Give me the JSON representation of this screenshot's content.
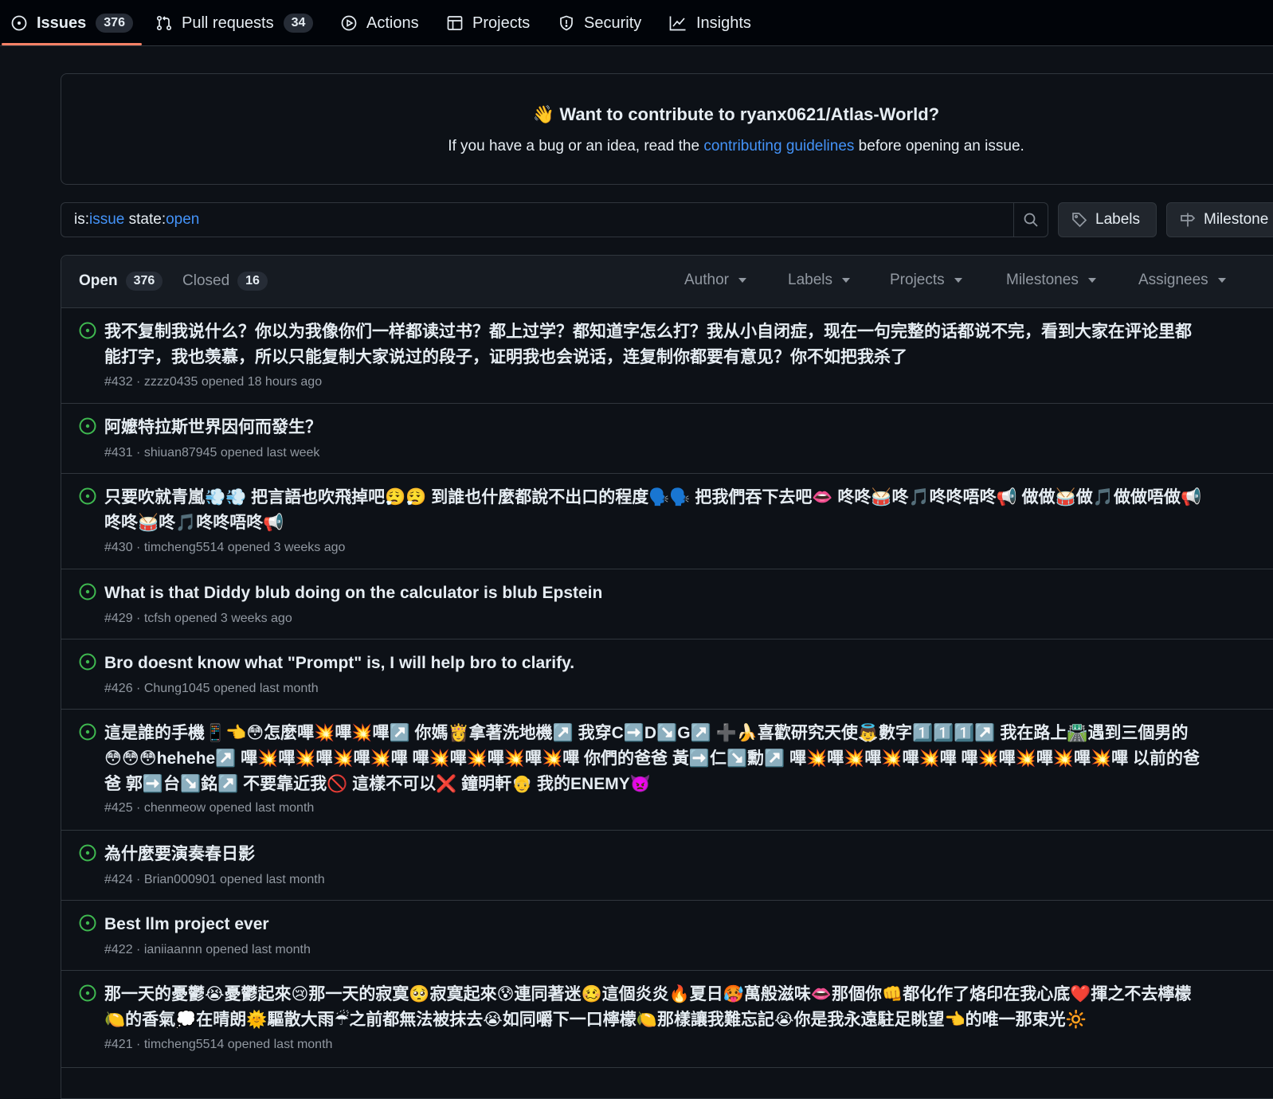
{
  "nav": {
    "tabs": [
      {
        "label": "Issues",
        "count": "376",
        "icon": "issue-opened-icon"
      },
      {
        "label": "Pull requests",
        "count": "34",
        "icon": "git-pull-request-icon"
      },
      {
        "label": "Actions",
        "icon": "play-icon"
      },
      {
        "label": "Projects",
        "icon": "table-icon"
      },
      {
        "label": "Security",
        "icon": "shield-icon"
      },
      {
        "label": "Insights",
        "icon": "graph-icon"
      }
    ]
  },
  "banner": {
    "title": "👋 Want to contribute to ryanx0621/Atlas-World?",
    "text_before": "If you have a bug or an idea, read the ",
    "link": "contributing guidelines",
    "text_after": " before opening an issue."
  },
  "search": {
    "prefix1": "is:",
    "value1": "issue",
    "prefix2": " state:",
    "value2": "open",
    "labels_button": "Labels",
    "milestones_button": "Milestone"
  },
  "list_header": {
    "open_label": "Open",
    "open_count": "376",
    "closed_label": "Closed",
    "closed_count": "16",
    "filters": [
      "Author",
      "Labels",
      "Projects",
      "Milestones",
      "Assignees"
    ]
  },
  "issues": [
    {
      "title": "我不复制我说什么？你以为我像你们一样都读过书？都上过学？都知道字怎么打？我从小自闭症，现在一句完整的话都说不完，看到大家在评论里都能打字，我也羡慕，所以只能复制大家说过的段子，证明我也会说话，连复制你都要有意见？你不如把我杀了",
      "meta": "#432 · zzzz0435 opened 18 hours ago"
    },
    {
      "title": "阿嬤特拉斯世界因何而發生？",
      "meta": "#431 · shiuan87945 opened last week"
    },
    {
      "title": "只要吹就青嵐💨💨 把言語也吹飛掉吧😮‍💨😮‍💨 到誰也什麼都說不出口的程度🗣️🗣️ 把我們吞下去吧👄 咚咚🥁咚🎵咚咚唔咚📢 做做🥁做🎵做做唔做📢 咚咚🥁咚🎵咚咚唔咚📢",
      "meta": "#430 · timcheng5514 opened 3 weeks ago"
    },
    {
      "title": "What is that Diddy blub doing on the calculator is blub Epstein",
      "meta": "#429 · tcfsh opened 3 weeks ago"
    },
    {
      "title": "Bro doesnt know what \"Prompt\" is, I will help bro to clarify.",
      "meta": "#426 · Chung1045 opened last month"
    },
    {
      "title": "這是誰的手機📱👈😳怎麼嗶💥嗶💥嗶↗️ 你媽👸拿著洗地機↗️ 我穿C➡️D↘️G↗️ ➕🍌喜歡研究天使👼數字1️⃣1️⃣1️⃣↗️ 我在路上🛣️遇到三個男的😳😳😳hehehe↗️ 嗶💥嗶💥嗶💥嗶💥嗶 嗶💥嗶💥嗶💥嗶💥嗶 你們的爸爸 黃➡️仁↘️勳↗️ 嗶💥嗶💥嗶💥嗶💥嗶 嗶💥嗶💥嗶💥嗶💥嗶 以前的爸爸 郭➡️台↘️銘↗️ 不要靠近我🚫 這樣不可以❌ 鐘明軒👴 我的ENEMY👿",
      "meta": "#425 · chenmeow opened last month"
    },
    {
      "title": "為什麼要演奏春日影",
      "meta": "#424 · Brian000901 opened last month"
    },
    {
      "title": "Best llm project ever",
      "meta": "#422 · ianiiaannn opened last month"
    },
    {
      "title": "那一天的憂鬱😭憂鬱起來😢那一天的寂寞🥺寂寞起來😰連同著迷🥴這個炎炎🔥夏日🥵萬般滋味👄那個你👊都化作了烙印在我心底❤️揮之不去檸檬🍋的香氣💭在晴朗🌞驅散大雨☔之前都無法被抹去😭如同嚼下一口檸檬🍋那樣讓我難忘記😭你是我永遠駐足眺望👈的唯一那束光🔆",
      "meta": "#421 · timcheng5514 opened last month"
    }
  ],
  "colors": {
    "open_icon": "#3fb950",
    "link": "#4493f8",
    "accent_underline": "#f78166"
  }
}
